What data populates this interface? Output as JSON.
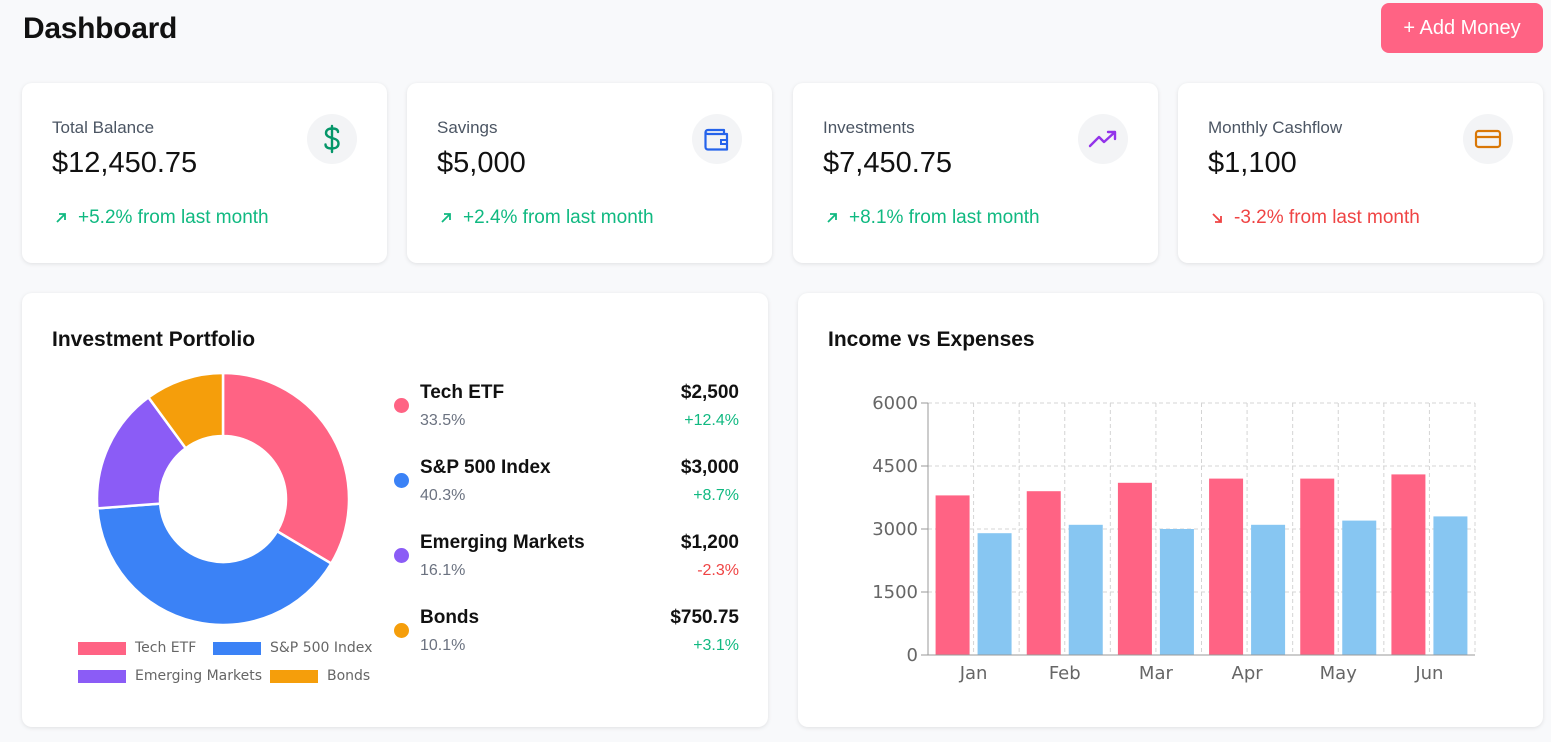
{
  "header": {
    "title": "Dashboard",
    "add_button": "+ Add Money"
  },
  "stats": [
    {
      "label": "Total Balance",
      "value": "$12,450.75",
      "change": "+5.2% from last month",
      "direction": "up",
      "icon": "dollar-icon",
      "icon_color": "#059669"
    },
    {
      "label": "Savings",
      "value": "$5,000",
      "change": "+2.4% from last month",
      "direction": "up",
      "icon": "wallet-icon",
      "icon_color": "#2563eb"
    },
    {
      "label": "Investments",
      "value": "$7,450.75",
      "change": "+8.1% from last month",
      "direction": "up",
      "icon": "trending-up-icon",
      "icon_color": "#9333ea"
    },
    {
      "label": "Monthly Cashflow",
      "value": "$1,100",
      "change": "-3.2% from last month",
      "direction": "down",
      "icon": "credit-card-icon",
      "icon_color": "#d97706"
    }
  ],
  "portfolio": {
    "title": "Investment Portfolio",
    "holdings": [
      {
        "name": "Tech ETF",
        "percent": "33.5%",
        "amount": "$2,500",
        "change": "+12.4%",
        "direction": "up",
        "color": "#ff6384"
      },
      {
        "name": "S&P 500 Index",
        "percent": "40.3%",
        "amount": "$3,000",
        "change": "+8.7%",
        "direction": "up",
        "color": "#3b82f6"
      },
      {
        "name": "Emerging Markets",
        "percent": "16.1%",
        "amount": "$1,200",
        "change": "-2.3%",
        "direction": "down",
        "color": "#8b5cf6"
      },
      {
        "name": "Bonds",
        "percent": "10.1%",
        "amount": "$750.75",
        "change": "+3.1%",
        "direction": "up",
        "color": "#f59e0b"
      }
    ]
  },
  "chart_data": [
    {
      "type": "pie",
      "categories": [
        "Tech ETF",
        "S&P 500 Index",
        "Emerging Markets",
        "Bonds"
      ],
      "values": [
        2500,
        3000,
        1200,
        750.75
      ],
      "colors": [
        "#ff6384",
        "#3b82f6",
        "#8b5cf6",
        "#f59e0b"
      ],
      "legend": "bottom"
    },
    {
      "type": "bar",
      "title": "Income vs Expenses",
      "categories": [
        "Jan",
        "Feb",
        "Mar",
        "Apr",
        "May",
        "Jun"
      ],
      "series": [
        {
          "values": [
            3800,
            3900,
            4100,
            4200,
            4200,
            4300
          ],
          "color": "#ff6384"
        },
        {
          "values": [
            2900,
            3100,
            3000,
            3100,
            3200,
            3300
          ],
          "color": "#87c6f2"
        }
      ],
      "ylim": [
        0,
        6000
      ],
      "yticks": [
        "0",
        "1500",
        "3000",
        "4500",
        "6000"
      ],
      "grid": true
    }
  ]
}
